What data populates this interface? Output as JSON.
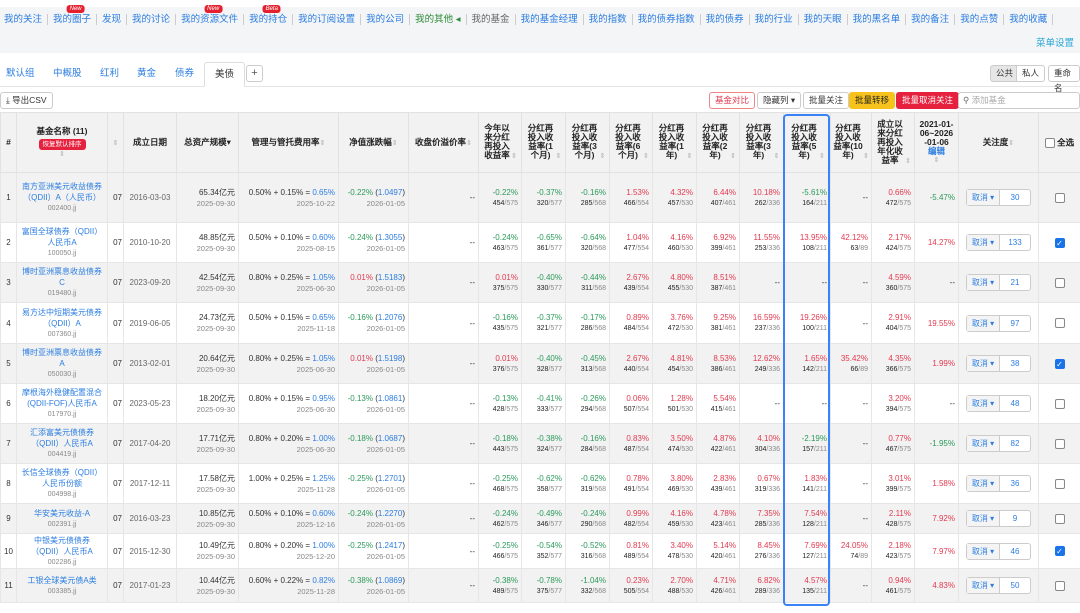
{
  "nav": {
    "items": [
      {
        "label": "我的关注",
        "style": ""
      },
      {
        "label": "我的圈子",
        "style": "",
        "badge": "New"
      },
      {
        "label": "发现",
        "style": ""
      },
      {
        "label": "我的讨论",
        "style": ""
      },
      {
        "label": "我的资源文件",
        "style": "",
        "badge": "New"
      },
      {
        "label": "我的持仓",
        "style": "",
        "badge": "Beta"
      },
      {
        "label": "我的订阅设置",
        "style": ""
      },
      {
        "label": "我的公司",
        "style": ""
      },
      {
        "label": "我的其他 ◂",
        "style": "green"
      },
      {
        "label": "我的基金",
        "style": "grey"
      },
      {
        "label": "我的基金经理",
        "style": ""
      },
      {
        "label": "我的指数",
        "style": ""
      },
      {
        "label": "我的债券指数",
        "style": ""
      },
      {
        "label": "我的债券",
        "style": ""
      },
      {
        "label": "我的行业",
        "style": ""
      },
      {
        "label": "我的天眼",
        "style": ""
      },
      {
        "label": "我的黑名单",
        "style": ""
      },
      {
        "label": "我的备注",
        "style": ""
      },
      {
        "label": "我的点赞",
        "style": ""
      },
      {
        "label": "我的收藏",
        "style": ""
      }
    ],
    "menu_settings": "菜单设置"
  },
  "tabs": [
    "默认组",
    "中概股",
    "红利",
    "黄金",
    "债券",
    "美债"
  ],
  "tab_add": "+",
  "visibility": {
    "public": "公共",
    "private": "私人",
    "rename": "重命名"
  },
  "toolbar": {
    "export": "导出CSV",
    "compare": "基金对比",
    "hide_cols": "隐藏列 ▾",
    "batch_watch": "批量关注",
    "batch_move": "批量转移",
    "batch_unwatch": "批量取消关注",
    "search_placeholder": "添加基金"
  },
  "colors": {
    "accent": "#2b7de1",
    "up": "#e23a50",
    "down": "#2a9a5a",
    "highlight": "#3b82f6"
  },
  "headers": {
    "no": "#",
    "name": "基金名称 (11)",
    "restore": "恢复默认排序",
    "founded": "成立日期",
    "aum": "总资产规模",
    "fee": "管理与管托费用率",
    "nav": "净值涨跌幅",
    "premium": "收盘价溢价率",
    "returns": [
      "今年以来分红再投入收益率",
      "分红再投入收益率(1个月)",
      "分红再投入收益率(3个月)",
      "分红再投入收益率(6个月)",
      "分红再投入收益率(1年)",
      "分红再投入收益率(2年)",
      "分红再投入收益率(3年)",
      "分红再投入收益率(5年)",
      "分红再投入收益率(10年)",
      "成立以来分红再投入年化收益率"
    ],
    "range": "2021-01-06~2026-01-06",
    "edit": "编辑",
    "watch": "关注度",
    "select_all": "全选"
  },
  "rows": [
    {
      "no": "1",
      "name": "南方亚洲美元收益债券（QDII）A（人民币）",
      "code": "002400.jj",
      "hidden": "07",
      "founded": "2016-03-03",
      "aum": "65.34亿元",
      "aum_date": "2025-09-30",
      "fee": "0.50% + 0.15% = ",
      "fee_total": "0.65%",
      "fee_date": "2025-10-22",
      "nav_chg": "-0.22%",
      "nav": "1.0497",
      "nav_date": "2026-01-05",
      "premium": "--",
      "returns": [
        [
          "-0.22%",
          "454",
          "/575"
        ],
        [
          "-0.37%",
          "320",
          "/577"
        ],
        [
          "-0.16%",
          "285",
          "/568"
        ],
        [
          "1.53%",
          "466",
          "/554"
        ],
        [
          "4.32%",
          "457",
          "/530"
        ],
        [
          "6.44%",
          "407",
          "/461"
        ],
        [
          "10.18%",
          "262",
          "/336"
        ],
        [
          "-5.61%",
          "164",
          "/211"
        ],
        null,
        [
          "0.66%",
          "472",
          "/575"
        ]
      ],
      "annualized": "-5.47%",
      "cancel": "取消",
      "watch": "30",
      "checked": false
    },
    {
      "no": "2",
      "name": "富国全球债券（QDII）人民币A",
      "code": "100050.jj",
      "hidden": "07",
      "founded": "2010-10-20",
      "aum": "48.85亿元",
      "aum_date": "2025-09-30",
      "fee": "0.50% + 0.10% = ",
      "fee_total": "0.60%",
      "fee_date": "2025-08-15",
      "nav_chg": "-0.24%",
      "nav": "1.3055",
      "nav_date": "2026-01-05",
      "premium": "--",
      "returns": [
        [
          "-0.24%",
          "463",
          "/575"
        ],
        [
          "-0.65%",
          "361",
          "/577"
        ],
        [
          "-0.64%",
          "320",
          "/568"
        ],
        [
          "1.04%",
          "477",
          "/554"
        ],
        [
          "4.16%",
          "460",
          "/530"
        ],
        [
          "6.92%",
          "399",
          "/461"
        ],
        [
          "11.55%",
          "253",
          "/336"
        ],
        [
          "13.95%",
          "108",
          "/211"
        ],
        [
          "42.12%",
          "63",
          "/89"
        ],
        [
          "2.17%",
          "424",
          "/575"
        ]
      ],
      "annualized": "14.27%",
      "cancel": "取消",
      "watch": "133",
      "checked": true
    },
    {
      "no": "3",
      "name": "博时亚洲票息收益债券C",
      "code": "019480.jj",
      "hidden": "07",
      "founded": "2023-09-20",
      "aum": "42.54亿元",
      "aum_date": "2025-09-30",
      "fee": "0.80% + 0.25% = ",
      "fee_total": "1.05%",
      "fee_date": "2025-06-30",
      "nav_chg": "0.01%",
      "nav": "1.5183",
      "nav_date": "2026-01-05",
      "premium": "--",
      "returns": [
        [
          "0.01%",
          "375",
          "/575"
        ],
        [
          "-0.40%",
          "330",
          "/577"
        ],
        [
          "-0.44%",
          "311",
          "/568"
        ],
        [
          "2.67%",
          "439",
          "/554"
        ],
        [
          "4.80%",
          "455",
          "/530"
        ],
        [
          "8.51%",
          "387",
          "/461"
        ],
        null,
        null,
        null,
        [
          "4.59%",
          "360",
          "/575"
        ]
      ],
      "annualized": "--",
      "cancel": "取消",
      "watch": "21",
      "checked": false
    },
    {
      "no": "4",
      "name": "易方达中短期美元债券（QDII）A",
      "code": "007360.jj",
      "hidden": "07",
      "founded": "2019-06-05",
      "aum": "24.73亿元",
      "aum_date": "2025-09-30",
      "fee": "0.50% + 0.15% = ",
      "fee_total": "0.65%",
      "fee_date": "2025-11-18",
      "nav_chg": "-0.16%",
      "nav": "1.2076",
      "nav_date": "2026-01-05",
      "premium": "--",
      "returns": [
        [
          "-0.16%",
          "435",
          "/575"
        ],
        [
          "-0.37%",
          "321",
          "/577"
        ],
        [
          "-0.17%",
          "286",
          "/568"
        ],
        [
          "0.89%",
          "484",
          "/554"
        ],
        [
          "3.76%",
          "472",
          "/530"
        ],
        [
          "9.25%",
          "381",
          "/461"
        ],
        [
          "16.59%",
          "237",
          "/336"
        ],
        [
          "19.26%",
          "100",
          "/211"
        ],
        null,
        [
          "2.91%",
          "404",
          "/575"
        ]
      ],
      "annualized": "19.55%",
      "cancel": "取消",
      "watch": "97",
      "checked": false
    },
    {
      "no": "5",
      "name": "博时亚洲票息收益债券A",
      "code": "050030.jj",
      "hidden": "07",
      "founded": "2013-02-01",
      "aum": "20.64亿元",
      "aum_date": "2025-09-30",
      "fee": "0.80% + 0.25% = ",
      "fee_total": "1.05%",
      "fee_date": "2025-06-30",
      "nav_chg": "0.01%",
      "nav": "1.5198",
      "nav_date": "2026-01-05",
      "premium": "--",
      "returns": [
        [
          "0.01%",
          "376",
          "/575"
        ],
        [
          "-0.40%",
          "328",
          "/577"
        ],
        [
          "-0.45%",
          "313",
          "/568"
        ],
        [
          "2.67%",
          "440",
          "/554"
        ],
        [
          "4.81%",
          "454",
          "/530"
        ],
        [
          "8.53%",
          "386",
          "/461"
        ],
        [
          "12.62%",
          "249",
          "/336"
        ],
        [
          "1.65%",
          "142",
          "/211"
        ],
        [
          "35.42%",
          "66",
          "/89"
        ],
        [
          "4.35%",
          "366",
          "/575"
        ]
      ],
      "annualized": "1.99%",
      "cancel": "取消",
      "watch": "38",
      "checked": true
    },
    {
      "no": "6",
      "name": "摩根海外稳健配置混合(QDII-FOF)人民币A",
      "code": "017970.jj",
      "hidden": "07",
      "founded": "2023-05-23",
      "aum": "18.20亿元",
      "aum_date": "2025-09-30",
      "fee": "0.80% + 0.15% = ",
      "fee_total": "0.95%",
      "fee_date": "2025-06-30",
      "nav_chg": "-0.13%",
      "nav": "1.0861",
      "nav_date": "2026-01-05",
      "premium": "--",
      "returns": [
        [
          "-0.13%",
          "428",
          "/575"
        ],
        [
          "-0.41%",
          "333",
          "/577"
        ],
        [
          "-0.26%",
          "294",
          "/568"
        ],
        [
          "0.06%",
          "507",
          "/554"
        ],
        [
          "1.28%",
          "501",
          "/530"
        ],
        [
          "5.54%",
          "415",
          "/461"
        ],
        null,
        null,
        null,
        [
          "3.20%",
          "394",
          "/575"
        ]
      ],
      "annualized": "--",
      "cancel": "取消",
      "watch": "48",
      "checked": false
    },
    {
      "no": "7",
      "name": "汇添富美元债债券（QDII）人民币A",
      "code": "004419.jj",
      "hidden": "07",
      "founded": "2017-04-20",
      "aum": "17.71亿元",
      "aum_date": "2025-09-30",
      "fee": "0.80% + 0.20% = ",
      "fee_total": "1.00%",
      "fee_date": "2025-06-30",
      "nav_chg": "-0.18%",
      "nav": "1.0687",
      "nav_date": "2026-01-05",
      "premium": "--",
      "returns": [
        [
          "-0.18%",
          "443",
          "/575"
        ],
        [
          "-0.38%",
          "324",
          "/577"
        ],
        [
          "-0.16%",
          "284",
          "/568"
        ],
        [
          "0.83%",
          "487",
          "/554"
        ],
        [
          "3.50%",
          "474",
          "/530"
        ],
        [
          "4.87%",
          "422",
          "/461"
        ],
        [
          "4.10%",
          "304",
          "/336"
        ],
        [
          "-2.19%",
          "157",
          "/211"
        ],
        null,
        [
          "0.77%",
          "467",
          "/575"
        ]
      ],
      "annualized": "-1.95%",
      "cancel": "取消",
      "watch": "82",
      "checked": false
    },
    {
      "no": "8",
      "name": "长信全球债券（QDII）人民币份额",
      "code": "004998.jj",
      "hidden": "07",
      "founded": "2017-12-11",
      "aum": "17.58亿元",
      "aum_date": "2025-09-30",
      "fee": "1.00% + 0.25% = ",
      "fee_total": "1.25%",
      "fee_date": "2025-11-28",
      "nav_chg": "-0.25%",
      "nav": "1.2701",
      "nav_date": "2026-01-05",
      "premium": "--",
      "returns": [
        [
          "-0.25%",
          "468",
          "/575"
        ],
        [
          "-0.62%",
          "358",
          "/577"
        ],
        [
          "-0.62%",
          "319",
          "/568"
        ],
        [
          "0.78%",
          "491",
          "/554"
        ],
        [
          "3.80%",
          "469",
          "/530"
        ],
        [
          "2.83%",
          "439",
          "/461"
        ],
        [
          "0.67%",
          "319",
          "/336"
        ],
        [
          "1.83%",
          "141",
          "/211"
        ],
        null,
        [
          "3.01%",
          "399",
          "/575"
        ]
      ],
      "annualized": "1.58%",
      "cancel": "取消",
      "watch": "36",
      "checked": false
    },
    {
      "no": "9",
      "name": "华安美元收益-A",
      "code": "002391.jj",
      "hidden": "07",
      "founded": "2016-03-23",
      "aum": "10.85亿元",
      "aum_date": "2025-09-30",
      "fee": "0.50% + 0.10% = ",
      "fee_total": "0.60%",
      "fee_date": "2025-12-16",
      "nav_chg": "-0.24%",
      "nav": "1.2270",
      "nav_date": "2026-01-05",
      "premium": "--",
      "returns": [
        [
          "-0.24%",
          "462",
          "/575"
        ],
        [
          "-0.49%",
          "346",
          "/577"
        ],
        [
          "-0.24%",
          "290",
          "/568"
        ],
        [
          "0.99%",
          "482",
          "/554"
        ],
        [
          "4.16%",
          "459",
          "/530"
        ],
        [
          "4.78%",
          "423",
          "/461"
        ],
        [
          "7.35%",
          "285",
          "/336"
        ],
        [
          "7.54%",
          "128",
          "/211"
        ],
        null,
        [
          "2.11%",
          "428",
          "/575"
        ]
      ],
      "annualized": "7.92%",
      "cancel": "取消",
      "watch": "9",
      "checked": false
    },
    {
      "no": "10",
      "name": "中银美元债债券（QDII）人民币A",
      "code": "002286.jj",
      "hidden": "07",
      "founded": "2015-12-30",
      "aum": "10.49亿元",
      "aum_date": "2025-09-30",
      "fee": "0.80% + 0.20% = ",
      "fee_total": "1.00%",
      "fee_date": "2025-12-20",
      "nav_chg": "-0.25%",
      "nav": "1.2417",
      "nav_date": "2026-01-05",
      "premium": "--",
      "returns": [
        [
          "-0.25%",
          "466",
          "/575"
        ],
        [
          "-0.54%",
          "352",
          "/577"
        ],
        [
          "-0.52%",
          "316",
          "/568"
        ],
        [
          "0.81%",
          "489",
          "/554"
        ],
        [
          "3.40%",
          "478",
          "/530"
        ],
        [
          "5.14%",
          "420",
          "/461"
        ],
        [
          "8.45%",
          "276",
          "/336"
        ],
        [
          "7.69%",
          "127",
          "/211"
        ],
        [
          "24.05%",
          "74",
          "/89"
        ],
        [
          "2.18%",
          "423",
          "/575"
        ]
      ],
      "annualized": "7.97%",
      "cancel": "取消",
      "watch": "46",
      "checked": true
    },
    {
      "no": "11",
      "name": "工银全球美元债A类",
      "code": "003385.jj",
      "hidden": "07",
      "founded": "2017-01-23",
      "aum": "10.44亿元",
      "aum_date": "2025-09-30",
      "fee": "0.60% + 0.22% = ",
      "fee_total": "0.82%",
      "fee_date": "2025-11-28",
      "nav_chg": "-0.38%",
      "nav": "1.0869",
      "nav_date": "2026-01-05",
      "premium": "--",
      "returns": [
        [
          "-0.38%",
          "489",
          "/575"
        ],
        [
          "-0.78%",
          "375",
          "/577"
        ],
        [
          "-1.04%",
          "332",
          "/568"
        ],
        [
          "0.23%",
          "505",
          "/554"
        ],
        [
          "2.70%",
          "488",
          "/530"
        ],
        [
          "4.71%",
          "426",
          "/461"
        ],
        [
          "6.82%",
          "289",
          "/336"
        ],
        [
          "4.57%",
          "135",
          "/211"
        ],
        null,
        [
          "0.94%",
          "461",
          "/575"
        ]
      ],
      "annualized": "4.83%",
      "cancel": "取消",
      "watch": "50",
      "checked": false
    }
  ],
  "empty": "--"
}
